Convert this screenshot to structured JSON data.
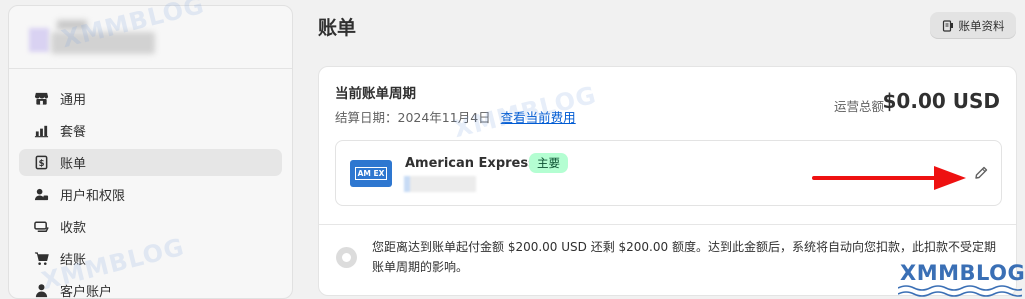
{
  "sidebar": {
    "items": [
      {
        "label": "通用",
        "icon": "store-icon",
        "active": false
      },
      {
        "label": "套餐",
        "icon": "plan-icon",
        "active": false
      },
      {
        "label": "账单",
        "icon": "billing-icon",
        "active": true
      },
      {
        "label": "用户和权限",
        "icon": "users-icon",
        "active": false
      },
      {
        "label": "收款",
        "icon": "payments-icon",
        "active": false
      },
      {
        "label": "结账",
        "icon": "cart-icon",
        "active": false
      },
      {
        "label": "客户账户",
        "icon": "person-icon",
        "active": false
      }
    ]
  },
  "header": {
    "title": "账单",
    "billing_profile_label": "账单资料"
  },
  "billing_cycle": {
    "title": "当前账单周期",
    "date_text": "结算日期：2024年11月4日",
    "view_charges_link": "查看当前费用",
    "total_label": "运营总额",
    "total_amount": "$0.00 USD"
  },
  "payment_method": {
    "card_brand": "American Express",
    "badge": "主要",
    "logo_text": "AM EX"
  },
  "notice": {
    "text": "您距离达到账单起付金额 $200.00 USD 还剩 $200.00 额度。达到此金额后，系统将自动向您扣款，此扣款不受定期账单周期的影响。"
  },
  "watermark": {
    "text": "XMMBLOG"
  },
  "colors": {
    "link": "#005bd3",
    "badge_bg": "#b4fed2",
    "badge_fg": "#0c5132",
    "amex": "#2e77d0",
    "arrow": "#ee1111"
  }
}
